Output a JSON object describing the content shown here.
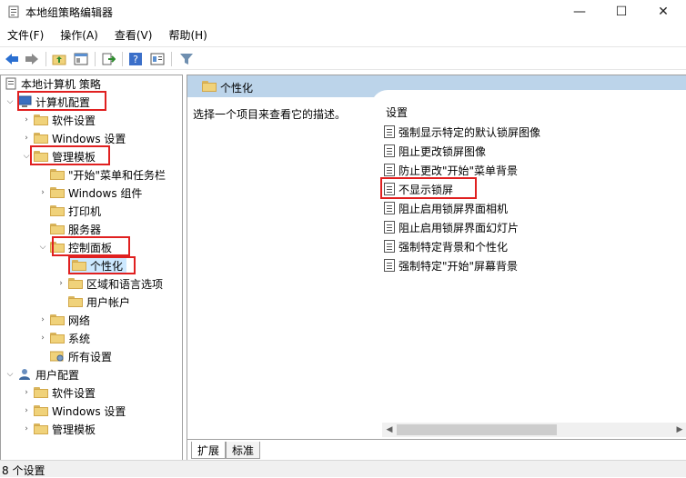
{
  "window": {
    "title": "本地组策略编辑器",
    "controls": {
      "minimize": "—",
      "maximize": "☐",
      "close": "✕"
    }
  },
  "menu": [
    "文件(F)",
    "操作(A)",
    "查看(V)",
    "帮助(H)"
  ],
  "toolbar_icons": [
    "back-arrow-icon",
    "forward-arrow-icon",
    "up-folder-icon",
    "show-hide-tree-icon",
    "export-list-icon",
    "help-icon",
    "properties-icon",
    "filter-icon"
  ],
  "tree": [
    {
      "label": "本地计算机 策略",
      "depth": 0,
      "arrow": "",
      "icon": "policy"
    },
    {
      "label": "计算机配置",
      "depth": 0,
      "arrow": "expanded",
      "icon": "computer",
      "highlighted": true
    },
    {
      "label": "软件设置",
      "depth": 1,
      "arrow": "collapsed",
      "icon": "folder"
    },
    {
      "label": "Windows 设置",
      "depth": 1,
      "arrow": "collapsed",
      "icon": "folder"
    },
    {
      "label": "管理模板",
      "depth": 1,
      "arrow": "expanded",
      "icon": "folder",
      "highlighted": true
    },
    {
      "label": "\"开始\"菜单和任务栏",
      "depth": 2,
      "arrow": "",
      "icon": "folder"
    },
    {
      "label": "Windows 组件",
      "depth": 2,
      "arrow": "collapsed",
      "icon": "folder"
    },
    {
      "label": "打印机",
      "depth": 2,
      "arrow": "",
      "icon": "folder"
    },
    {
      "label": "服务器",
      "depth": 2,
      "arrow": "",
      "icon": "folder"
    },
    {
      "label": "控制面板",
      "depth": 2,
      "arrow": "expanded",
      "icon": "folder",
      "highlighted": true
    },
    {
      "label": "个性化",
      "depth": 3,
      "arrow": "",
      "icon": "folder",
      "highlighted": true,
      "selected": true
    },
    {
      "label": "区域和语言选项",
      "depth": 3,
      "arrow": "collapsed",
      "icon": "folder"
    },
    {
      "label": "用户帐户",
      "depth": 3,
      "arrow": "",
      "icon": "folder"
    },
    {
      "label": "网络",
      "depth": 2,
      "arrow": "collapsed",
      "icon": "folder"
    },
    {
      "label": "系统",
      "depth": 2,
      "arrow": "collapsed",
      "icon": "folder"
    },
    {
      "label": "所有设置",
      "depth": 2,
      "arrow": "",
      "icon": "settings"
    },
    {
      "label": "用户配置",
      "depth": 0,
      "arrow": "expanded",
      "icon": "user"
    },
    {
      "label": "软件设置",
      "depth": 1,
      "arrow": "collapsed",
      "icon": "folder"
    },
    {
      "label": "Windows 设置",
      "depth": 1,
      "arrow": "collapsed",
      "icon": "folder"
    },
    {
      "label": "管理模板",
      "depth": 1,
      "arrow": "collapsed",
      "icon": "folder"
    }
  ],
  "details": {
    "header_title": "个性化",
    "description": "选择一个项目来查看它的描述。",
    "column_header": "设置",
    "settings": [
      {
        "label": "强制显示特定的默认锁屏图像"
      },
      {
        "label": "阻止更改锁屏图像"
      },
      {
        "label": "防止更改\"开始\"菜单背景"
      },
      {
        "label": "不显示锁屏",
        "highlighted": true
      },
      {
        "label": "阻止启用锁屏界面相机"
      },
      {
        "label": "阻止启用锁屏界面幻灯片"
      },
      {
        "label": "强制特定背景和个性化"
      },
      {
        "label": "强制特定\"开始\"屏幕背景"
      }
    ]
  },
  "tabs": [
    {
      "label": "扩展",
      "active": true
    },
    {
      "label": "标准",
      "active": false
    }
  ],
  "status": {
    "text": "8 个设置"
  },
  "colors": {
    "highlight_border": "#e02020",
    "header_bg": "#bcd4ea",
    "selection_bg": "#cce8ff"
  }
}
